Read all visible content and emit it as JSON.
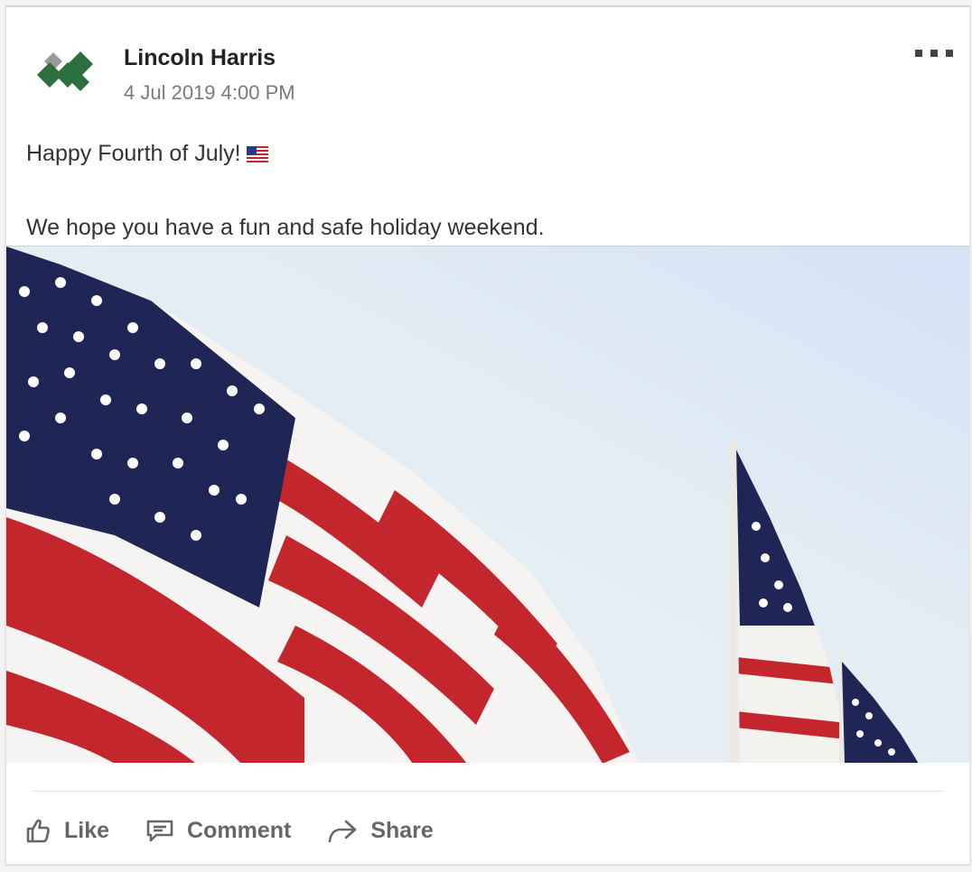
{
  "post": {
    "author": "Lincoln Harris",
    "timestamp": "4 Jul 2019 4:00 PM",
    "line1": "Happy Fourth of July!",
    "line2": "We hope you have a fun and safe holiday weekend.",
    "image_subject": "American flags waving against a pale blue sky"
  },
  "actions": {
    "like": "Like",
    "comment": "Comment",
    "share": "Share"
  },
  "icons": {
    "avatar": "company-logo-icon",
    "more": "more-options-icon",
    "emoji": "us-flag-emoji",
    "like": "thumbs-up-icon",
    "comment": "comment-icon",
    "share": "share-arrow-icon"
  },
  "colors": {
    "logo_green": "#2e6f3f",
    "logo_gray": "#9a9a9a",
    "action_gray": "#666666",
    "flag_red": "#c4262e",
    "flag_blue": "#1f2555"
  }
}
